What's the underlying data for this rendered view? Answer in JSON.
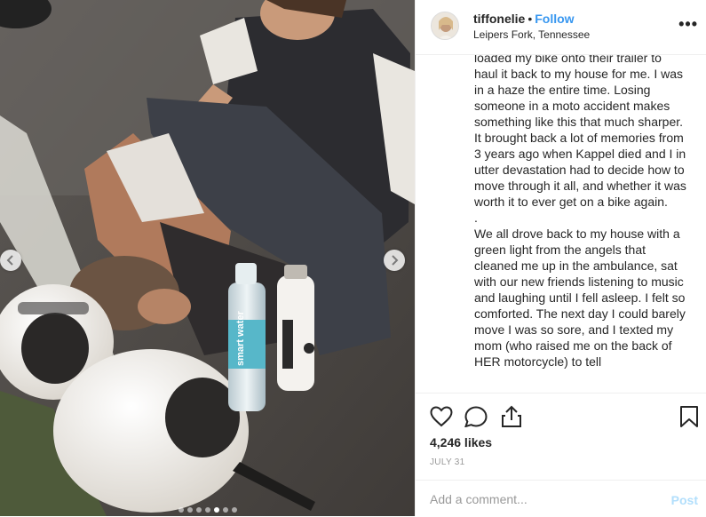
{
  "header": {
    "username": "tiffonelie",
    "separator": "•",
    "follow_label": "Follow",
    "location": "Leipers Fork, Tennessee",
    "more_icon": "more-options-icon",
    "more_label": "•••"
  },
  "caption": {
    "lines_block_1": "loaded my bike onto their trailer to haul it back to my house for me. I was in a haze the entire time. Losing someone in a moto accident makes something like this that much sharper. It brought back a lot of memories from 3 years ago when Kappel died and I in utter devastation had to decide how to move through it all, and whether it was worth it to ever get on a bike again.",
    "divider": ".",
    "lines_block_2": "We all drove back to my house with a green light from the angels that cleaned me up in the ambulance, sat with our new friends listening to music and laughing until I fell asleep. I felt so comforted. The next day I could barely move I was so sore, and I texted my mom (who raised me on the back of HER motorcycle) to tell"
  },
  "actions": {
    "like_icon": "heart-icon",
    "comment_icon": "comment-icon",
    "share_icon": "share-icon",
    "save_icon": "bookmark-icon"
  },
  "likes_text": "4,246 likes",
  "date_text": "JULY 31",
  "comment": {
    "placeholder": "Add a comment...",
    "post_label": "Post"
  },
  "carousel": {
    "slide_count": 7,
    "active_index": 4,
    "bottle_label": "smart water"
  },
  "colors": {
    "accent": "#3897f0",
    "post_disabled": "#b2dffc",
    "muted": "#999999",
    "border": "#efefef"
  }
}
